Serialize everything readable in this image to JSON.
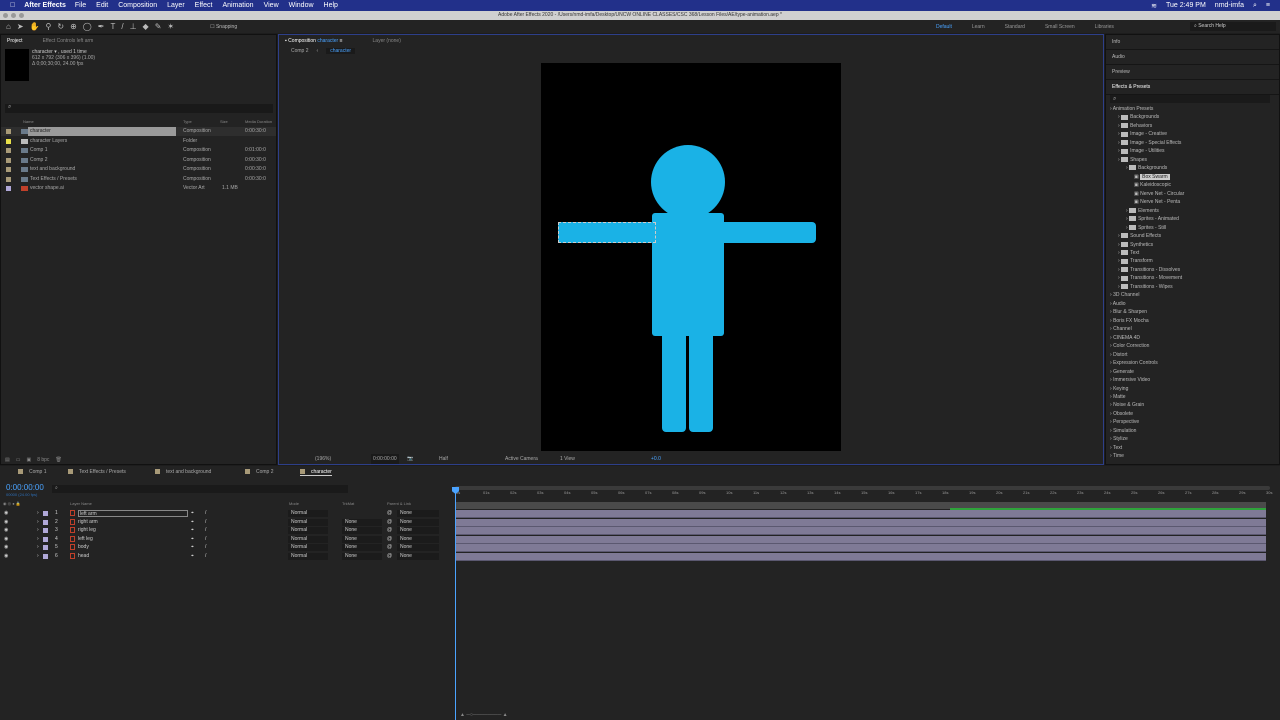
{
  "menubar": {
    "app": "After Effects",
    "items": [
      "File",
      "Edit",
      "Composition",
      "Layer",
      "Effect",
      "Animation",
      "View",
      "Window",
      "Help"
    ],
    "clock": "Tue 2:49 PM",
    "user": "nmd-imfa"
  },
  "window_title": "Adobe After Effects 2020 - /Users/nmd-imfa/Desktop/UNCW ONLINE CLASSES/CSC 368/Lesson Files/AE/type-animation.aep *",
  "toolbar": {
    "snapping": "Snapping",
    "workspaces": [
      "Default",
      "Learn",
      "Standard",
      "Small Screen",
      "Libraries"
    ],
    "search_placeholder": "Search Help"
  },
  "project": {
    "tab": "Project",
    "effect_controls": "Effect Controls left arm",
    "info_name": "character ▾ , used 1 time",
    "info_dims": "612 x 792  (306 x 396) (1.00)",
    "info_dur": "Δ 0;00;30;00, 24.00 fps",
    "bpc": "8 bpc",
    "columns": [
      "Name",
      "Type",
      "Size",
      "Media Duration"
    ],
    "items": [
      {
        "name": "character",
        "type": "Composition",
        "size": "",
        "dur": "0:00:30:0",
        "color": "#a89a78",
        "kind": "comp"
      },
      {
        "name": "character Layers",
        "type": "Folder",
        "size": "",
        "dur": "",
        "color": "#e8e04a",
        "kind": "folder"
      },
      {
        "name": "Comp 1",
        "type": "Composition",
        "size": "",
        "dur": "0:01:00:0",
        "color": "#a89a78",
        "kind": "comp"
      },
      {
        "name": "Comp 2",
        "type": "Composition",
        "size": "",
        "dur": "0:00:30:0",
        "color": "#a89a78",
        "kind": "comp"
      },
      {
        "name": "text and background",
        "type": "Composition",
        "size": "",
        "dur": "0:00:30:0",
        "color": "#a89a78",
        "kind": "comp"
      },
      {
        "name": "Text Effects / Presets",
        "type": "Composition",
        "size": "",
        "dur": "0:00:30:0",
        "color": "#a89a78",
        "kind": "comp"
      },
      {
        "name": "vector shape.ai",
        "type": "Vector Art",
        "size": "1.1 MB",
        "dur": "",
        "color": "#b0a8d8",
        "kind": "ai"
      }
    ]
  },
  "composition": {
    "tab": "Composition",
    "tab_name": "character",
    "layer_tab": "Layer (none)",
    "breadcrumb": [
      "Comp 2",
      "character"
    ],
    "footer": {
      "zoom": "(196%)",
      "time": "0:00:00:00",
      "resolution": "Half",
      "camera": "Active Camera",
      "view": "1 View",
      "exposure": "+0.0"
    },
    "figure_color": "#1ab2e6"
  },
  "right": {
    "panels": [
      "Info",
      "Audio",
      "Preview",
      "Effects & Presets"
    ],
    "tree": [
      {
        "t": "Animation Presets",
        "d": 0,
        "f": 0
      },
      {
        "t": "Backgrounds",
        "d": 1,
        "f": 1
      },
      {
        "t": "Behaviors",
        "d": 1,
        "f": 1
      },
      {
        "t": "Image - Creative",
        "d": 1,
        "f": 1
      },
      {
        "t": "Image - Special Effects",
        "d": 1,
        "f": 1
      },
      {
        "t": "Image - Utilities",
        "d": 1,
        "f": 1
      },
      {
        "t": "Shapes",
        "d": 1,
        "f": 1
      },
      {
        "t": "Backgrounds",
        "d": 2,
        "f": 1
      },
      {
        "t": "Box Swarm",
        "d": 3,
        "f": 2,
        "sel": 1
      },
      {
        "t": "Kaleidoscopic",
        "d": 3,
        "f": 2
      },
      {
        "t": "Nerve Net - Circular",
        "d": 3,
        "f": 2
      },
      {
        "t": "Nerve Net - Penta",
        "d": 3,
        "f": 2
      },
      {
        "t": "Elements",
        "d": 2,
        "f": 1
      },
      {
        "t": "Sprites - Animated",
        "d": 2,
        "f": 1
      },
      {
        "t": "Sprites - Still",
        "d": 2,
        "f": 1
      },
      {
        "t": "Sound Effects",
        "d": 1,
        "f": 1
      },
      {
        "t": "Synthetics",
        "d": 1,
        "f": 1
      },
      {
        "t": "Text",
        "d": 1,
        "f": 1
      },
      {
        "t": "Transform",
        "d": 1,
        "f": 1
      },
      {
        "t": "Transitions - Dissolves",
        "d": 1,
        "f": 1
      },
      {
        "t": "Transitions - Movement",
        "d": 1,
        "f": 1
      },
      {
        "t": "Transitions - Wipes",
        "d": 1,
        "f": 1
      },
      {
        "t": "3D Channel",
        "d": 0,
        "f": 0
      },
      {
        "t": "Audio",
        "d": 0,
        "f": 0
      },
      {
        "t": "Blur & Sharpen",
        "d": 0,
        "f": 0
      },
      {
        "t": "Boris FX Mocha",
        "d": 0,
        "f": 0
      },
      {
        "t": "Channel",
        "d": 0,
        "f": 0
      },
      {
        "t": "CINEMA 4D",
        "d": 0,
        "f": 0
      },
      {
        "t": "Color Correction",
        "d": 0,
        "f": 0
      },
      {
        "t": "Distort",
        "d": 0,
        "f": 0
      },
      {
        "t": "Expression Controls",
        "d": 0,
        "f": 0
      },
      {
        "t": "Generate",
        "d": 0,
        "f": 0
      },
      {
        "t": "Immersive Video",
        "d": 0,
        "f": 0
      },
      {
        "t": "Keying",
        "d": 0,
        "f": 0
      },
      {
        "t": "Matte",
        "d": 0,
        "f": 0
      },
      {
        "t": "Noise & Grain",
        "d": 0,
        "f": 0
      },
      {
        "t": "Obsolete",
        "d": 0,
        "f": 0
      },
      {
        "t": "Perspective",
        "d": 0,
        "f": 0
      },
      {
        "t": "Simulation",
        "d": 0,
        "f": 0
      },
      {
        "t": "Stylize",
        "d": 0,
        "f": 0
      },
      {
        "t": "Text",
        "d": 0,
        "f": 0
      },
      {
        "t": "Time",
        "d": 0,
        "f": 0
      }
    ]
  },
  "timeline": {
    "tabs": [
      "Comp 1",
      "Text Effects / Presets",
      "text and background",
      "Comp 2",
      "character"
    ],
    "timecode": "0:00:00:00",
    "fps": "00000 (24.00 fps)",
    "columns": {
      "name": "Layer Name",
      "mode": "Mode",
      "trkmat": "TrkMat",
      "parent": "Parent & Link"
    },
    "ticks": [
      "0s",
      "01s",
      "02s",
      "03s",
      "04s",
      "05s",
      "06s",
      "07s",
      "08s",
      "09s",
      "10s",
      "11s",
      "12s",
      "13s",
      "14s",
      "15s",
      "16s",
      "17s",
      "18s",
      "19s",
      "20s",
      "21s",
      "22s",
      "23s",
      "24s",
      "25s",
      "26s",
      "27s",
      "28s",
      "29s",
      "30s"
    ],
    "layers": [
      {
        "n": "1",
        "name": "left arm",
        "mode": "Normal",
        "trk": "",
        "parent": "None"
      },
      {
        "n": "2",
        "name": "right arm",
        "mode": "Normal",
        "trk": "None",
        "parent": "None"
      },
      {
        "n": "3",
        "name": "right leg",
        "mode": "Normal",
        "trk": "None",
        "parent": "None"
      },
      {
        "n": "4",
        "name": "left leg",
        "mode": "Normal",
        "trk": "None",
        "parent": "None"
      },
      {
        "n": "5",
        "name": "body",
        "mode": "Normal",
        "trk": "None",
        "parent": "None"
      },
      {
        "n": "6",
        "name": "head",
        "mode": "Normal",
        "trk": "None",
        "parent": "None"
      }
    ]
  }
}
